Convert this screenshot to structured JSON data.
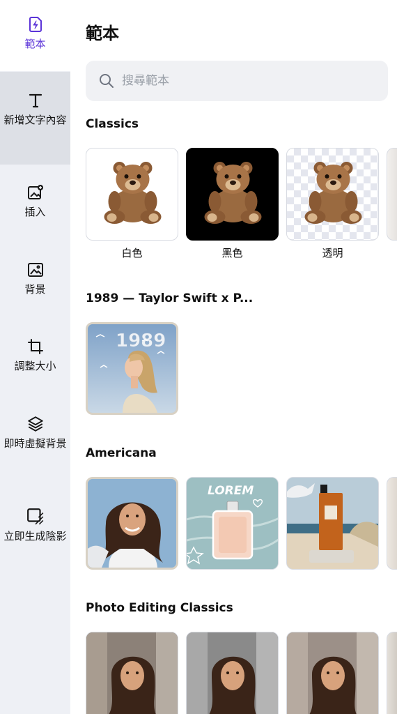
{
  "sidebar": {
    "items": [
      {
        "label": "範本",
        "icon": "template-icon"
      },
      {
        "label": "新增文字內容",
        "icon": "text-icon"
      },
      {
        "label": "插入",
        "icon": "add-image-icon"
      },
      {
        "label": "背景",
        "icon": "image-icon"
      },
      {
        "label": "調整大小",
        "icon": "crop-icon"
      },
      {
        "label": "即時虛擬背景",
        "icon": "layers-icon"
      },
      {
        "label": "立即生成陰影",
        "icon": "shadow-icon"
      }
    ]
  },
  "main": {
    "title": "範本",
    "search": {
      "placeholder": "搜尋範本"
    },
    "sections": [
      {
        "title": "Classics",
        "cards": [
          {
            "label": "白色"
          },
          {
            "label": "黑色"
          },
          {
            "label": "透明"
          }
        ]
      },
      {
        "title": "1989 — Taylor Swift x P..."
      },
      {
        "title": "Americana"
      },
      {
        "title": "Photo Editing Classics"
      }
    ]
  },
  "graphics": {
    "poster_text": "1989",
    "perfume_text": "LOREM"
  },
  "colors": {
    "accent": "#5b34d8",
    "sidebar_bg": "#eef0f5",
    "sidebar_selected": "#dde0e6"
  }
}
